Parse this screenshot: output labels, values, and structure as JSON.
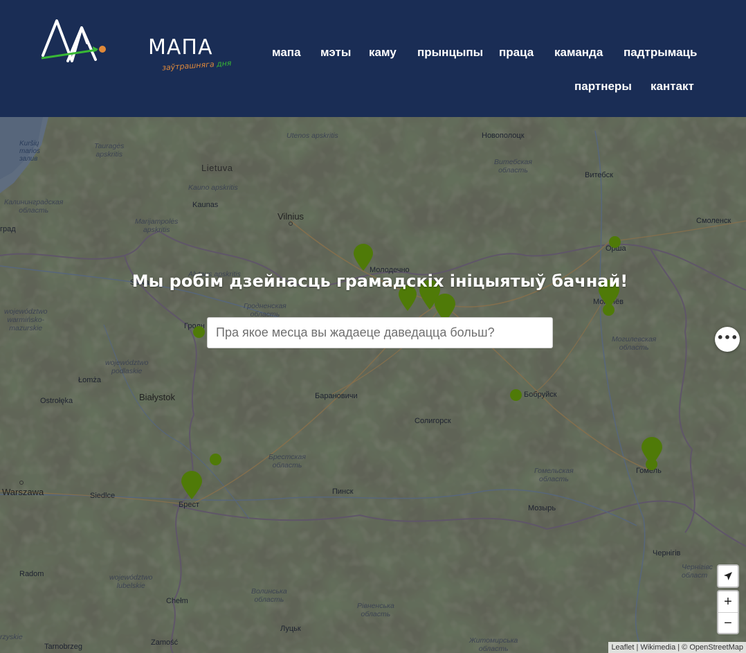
{
  "brand": {
    "name": "МАПА",
    "tagline_a": "заўтрашняга",
    "tagline_b": "дня"
  },
  "nav": {
    "items": [
      {
        "label": "мапа"
      },
      {
        "label": "мэты"
      },
      {
        "label": "каму"
      },
      {
        "label": "прынцыпы"
      },
      {
        "label": "праца"
      },
      {
        "label": "каманда"
      },
      {
        "label": "падтрымаць"
      },
      {
        "label": "партнеры"
      },
      {
        "label": "кантакт"
      }
    ]
  },
  "hero": {
    "title": "Мы робім дзейнасць грамадскіх ініцыятыў бачнай!",
    "search_placeholder": "Пра якое месца вы жадаеце даведацца больш?"
  },
  "map": {
    "labels": {
      "kursiu": "Kuršių\nmarios\nзалив",
      "taurages": "Tauragės\napskritis",
      "lietuva": "Lietuva",
      "kaunas_apsk": "Kauno apskritis",
      "kaunas": "Kaunas",
      "vilnius": "Vilnius",
      "utenos": "Utenos apskritis",
      "novopolotsk": "Новополоцк",
      "vitebsk_obl": "Витебская\nобласть",
      "vitebsk": "Витебск",
      "smolensk": "Смоленск",
      "kaliningrad_obl": "Калининградская\nобласть",
      "grad": "град",
      "marijampoles": "Marijampolės\napskritis",
      "alytaus": "Alytaus apskritis",
      "suw": "Suwa",
      "molodechno": "Молодечно",
      "orsha": "Орша",
      "mogilev": "Могилёв",
      "grodno_obl": "Гродненская\nобласть",
      "warminsko": "województwo\nwarmińsko-\nmazurskie",
      "grodno": "Гродн",
      "mogilev_obl": "Могилевская\nобласть",
      "podlaskie": "województwo\npodlaskie",
      "lomza": "Łomża",
      "ostroleka": "Ostrołęka",
      "bialystok": "Białystok",
      "baranovichi": "Барановичи",
      "bobruisk": "Бобруйск",
      "soligorsk": "Солигорск",
      "brest_obl": "Брестская\nобласть",
      "gomel_obl": "Гомельская\nобласть",
      "gomel": "Гомель",
      "warszawa": "Warszawa",
      "siedlce": "Siedlce",
      "brest": "Брест",
      "pinsk": "Пинск",
      "mozyr": "Мозырь",
      "chernigov": "Чернігів",
      "chernigov_obl": "Чернігівс\nобласт",
      "radom": "Radom",
      "lubelskie": "województwo\nlubelskie",
      "volyn": "Волинська\nобласть",
      "rivne": "Рівненська\nобласть",
      "chelm": "Chełm",
      "krzyskie": "rzyskie",
      "lutsk": "Луцьк",
      "tarnobrzeg": "Tarnobrzeg",
      "zamosc": "Zamość",
      "zhytomyr": "Житомирська\nобласть"
    },
    "controls": {
      "more": "•••",
      "locate_icon": "location-arrow-icon",
      "zoom_in": "+",
      "zoom_out": "−"
    },
    "attribution": {
      "leaflet": "Leaflet",
      "sep": "|",
      "wikimedia": "Wikimedia",
      "osm": "© OpenStreetMap"
    },
    "marker_color": "#4f7a08"
  }
}
